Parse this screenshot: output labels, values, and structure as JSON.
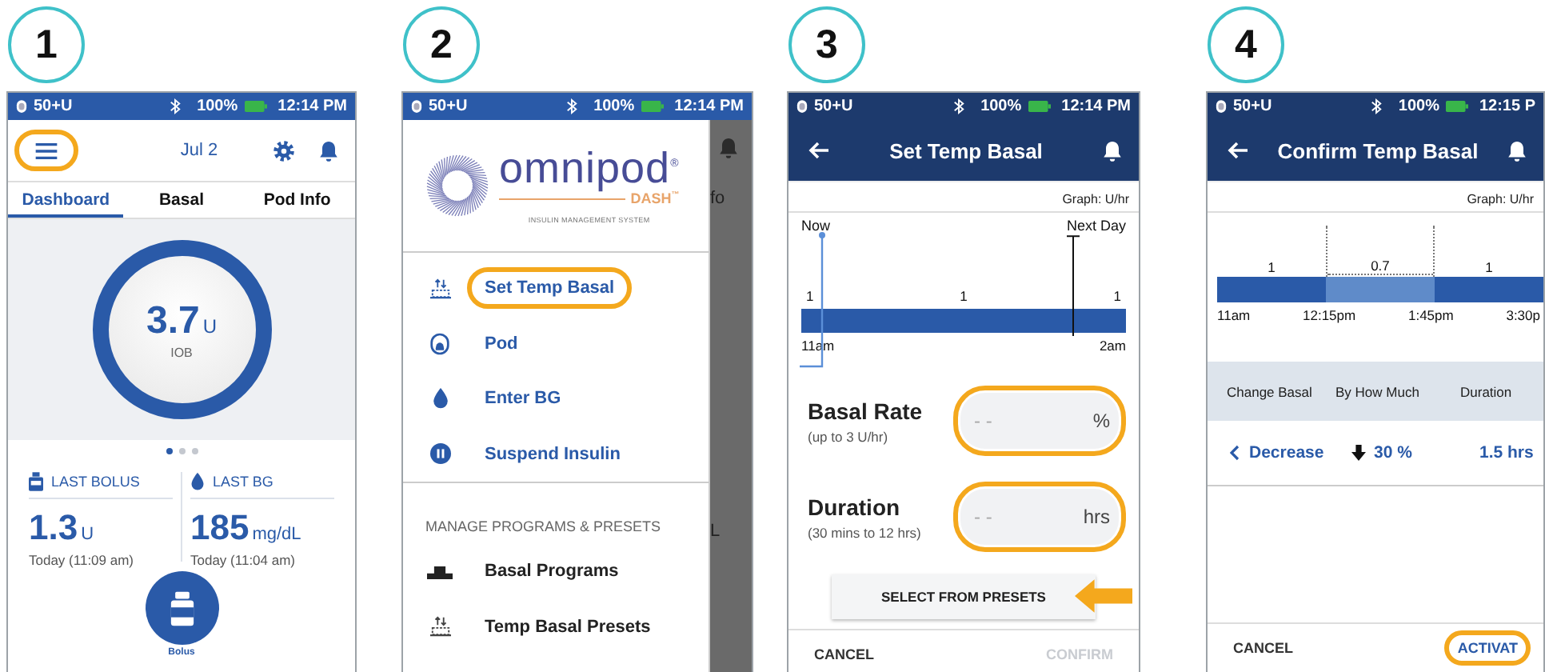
{
  "panels": [
    {
      "step": "1",
      "screen": {
        "kind": "dashboard",
        "status_bar": {
          "reservoir": "50+U",
          "battery": "100%",
          "time": "12:14 PM"
        },
        "header": {
          "date": "Jul 2",
          "menu_highlighted": true
        },
        "tabs": [
          {
            "label": "Dashboard",
            "selected": true
          },
          {
            "label": "Basal",
            "selected": false
          },
          {
            "label": "Pod Info",
            "selected": false
          }
        ],
        "iob": {
          "value": "3.7",
          "unit": "U",
          "label": "IOB"
        },
        "page_dots": [
          {
            "selected": true
          },
          {
            "selected": false
          },
          {
            "selected": false
          }
        ],
        "stats": [
          {
            "kind": "bolus",
            "title": "LAST BOLUS",
            "value": "1.3",
            "unit": "U",
            "time": "Today (11:09 am)"
          },
          {
            "kind": "bg",
            "title": "LAST BG",
            "value": "185",
            "unit": "mg/dL",
            "time": "Today (11:04 am)"
          }
        ],
        "bolus_button": {
          "label": "Bolus"
        }
      }
    },
    {
      "step": "2",
      "screen": {
        "kind": "menu",
        "status_bar": {
          "reservoir": "50+U",
          "battery": "100%",
          "time": "12:14 PM"
        },
        "logo": {
          "name": "omnipod$^{®}$",
          "product": "DASH$^{™}$",
          "tagline": "INSULIN MANAGEMENT SYSTEM"
        },
        "items": [
          {
            "kind": "temp_basal",
            "label": "Set Temp Basal",
            "highlighted": true
          },
          {
            "kind": "pod",
            "label": "Pod",
            "highlighted": false
          },
          {
            "kind": "blood_glucose",
            "label": "Enter BG",
            "highlighted": false
          },
          {
            "kind": "suspend",
            "label": "Suspend Insulin",
            "highlighted": false
          }
        ],
        "section_title": "MANAGE PROGRAMS & PRESETS",
        "program_items": [
          {
            "kind": "basal_program",
            "label": "Basal Programs"
          },
          {
            "kind": "temp_basal",
            "label": "Temp Basal Presets"
          }
        ],
        "background_texts": [
          "fo",
          "L"
        ]
      }
    },
    {
      "step": "3",
      "screen": {
        "kind": "set_temp_basal",
        "status_bar": {
          "reservoir": "50+U",
          "battery": "100%",
          "time": "12:14 PM"
        },
        "title": "Set Temp Basal",
        "graph": {
          "unit_label": "Graph: U/hr",
          "now": "Now",
          "next_day": "Next Day",
          "rates": [
            "1",
            "1",
            "1"
          ],
          "times": [
            "11am",
            "2am"
          ]
        },
        "fields": [
          {
            "label": "Basal Rate",
            "hint": "(up to 3 U/hr)",
            "placeholder": "- -",
            "unit": "%",
            "highlighted": true
          },
          {
            "label": "Duration",
            "hint": "(30 mins to 12 hrs)",
            "placeholder": "- -",
            "unit": "hrs",
            "highlighted": true
          }
        ],
        "presets_button": {
          "label": "SELECT FROM PRESETS",
          "pointed": true
        },
        "footer": [
          {
            "label": "CANCEL",
            "disabled": false
          },
          {
            "label": "CONFIRM",
            "disabled": true
          }
        ]
      }
    },
    {
      "step": "4",
      "screen": {
        "kind": "confirm_temp_basal",
        "status_bar": {
          "reservoir": "50+U",
          "battery": "100%",
          "time": "12:15 P"
        },
        "title": "Confirm Temp Basal",
        "graph": {
          "unit_label": "Graph: U/hr",
          "segments": [
            {
              "kind": "basal",
              "rate": "1"
            },
            {
              "kind": "temp",
              "rate": "0.7"
            },
            {
              "kind": "basal",
              "rate": "1"
            }
          ],
          "times": [
            "11am",
            "12:15pm",
            "1:45pm",
            "3:30p"
          ]
        },
        "summary": {
          "columns": [
            "Change Basal",
            "By How Much",
            "Duration"
          ],
          "change": "Decrease",
          "amount": "30 %",
          "duration": "1.5 hrs"
        },
        "footer": [
          {
            "label": "CANCEL",
            "highlighted": false
          },
          {
            "label": "ACTIVAT",
            "highlighted": true
          }
        ]
      }
    }
  ]
}
